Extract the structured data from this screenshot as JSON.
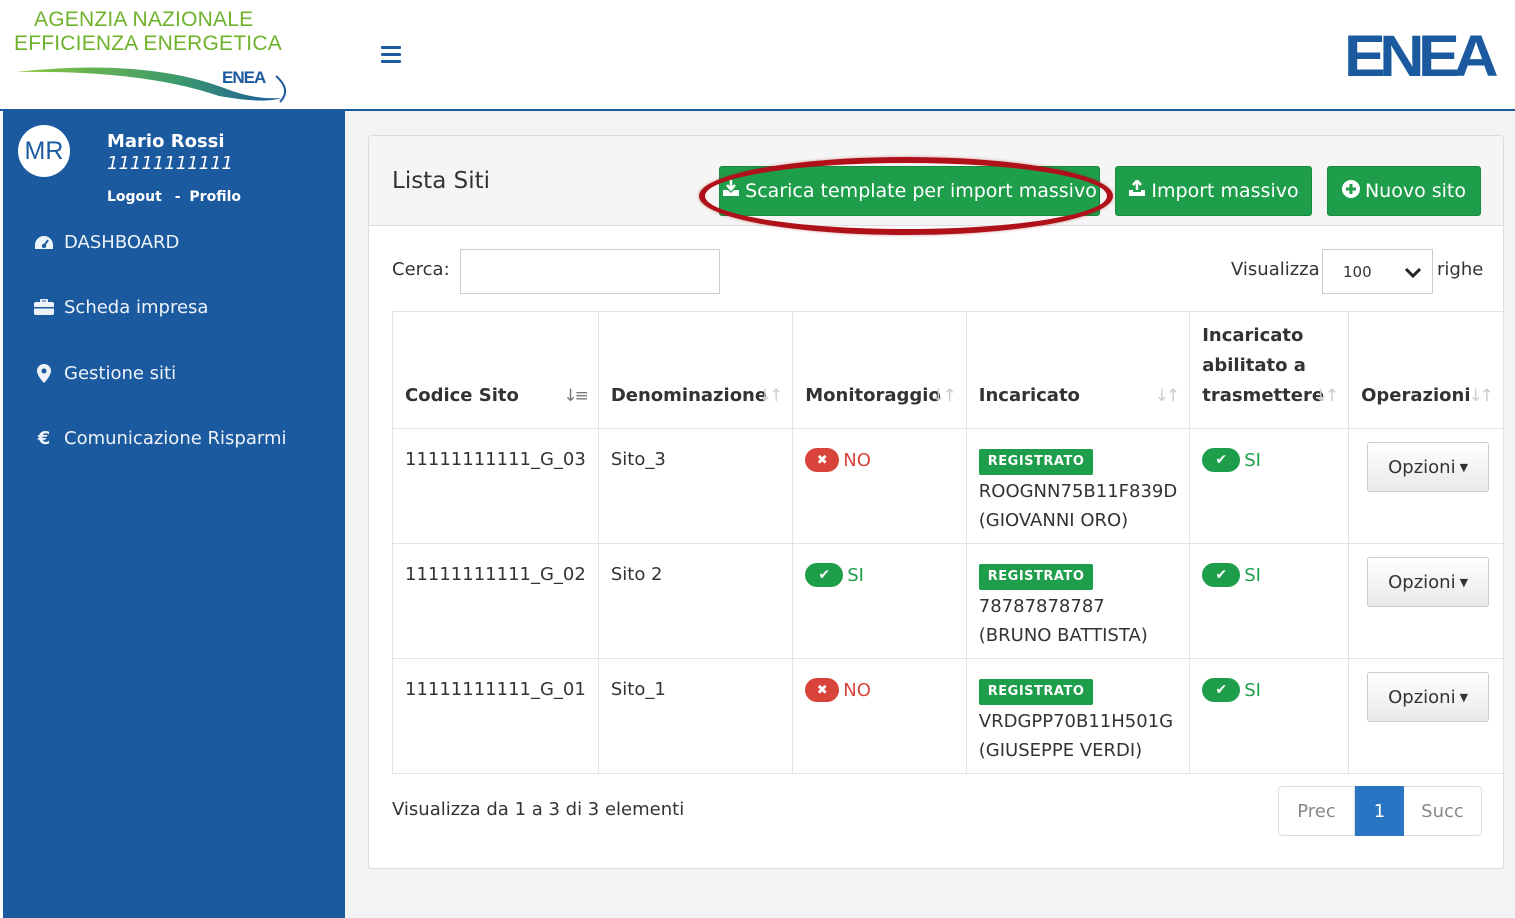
{
  "header": {
    "agency_line1": "AGENZIA NAZIONALE",
    "agency_line2": "EFFICIENZA ENERGETICA",
    "agency_mini_logo": "ENEA",
    "logo_text": "ENEA"
  },
  "user": {
    "initials": "MR",
    "name": "Mario Rossi",
    "code": "11111111111",
    "logout_label": "Logout",
    "separator": "-",
    "profile_label": "Profilo"
  },
  "sidebar": {
    "items": [
      {
        "label": "DASHBOARD",
        "icon": "dashboard-icon"
      },
      {
        "label": "Scheda impresa",
        "icon": "briefcase-icon"
      },
      {
        "label": "Gestione siti",
        "icon": "map-marker-icon"
      },
      {
        "label": "Comunicazione Risparmi",
        "icon": "euro-icon"
      }
    ]
  },
  "panel": {
    "title": "Lista Siti",
    "buttons": {
      "download_template": "Scarica template per import massivo",
      "import": "Import massivo",
      "new_site": "Nuovo sito"
    },
    "search_label": "Cerca:",
    "search_value": "",
    "show_label": "Visualizza",
    "rows_value": "100",
    "rows_suffix": "righe"
  },
  "table": {
    "columns": [
      "Codice Sito",
      "Denominazione",
      "Monitoraggio",
      "Incaricato",
      "Incaricato abilitato a trasmettere",
      "Operazioni"
    ],
    "rows": [
      {
        "codice": "11111111111_G_03",
        "denominazione": "Sito_3",
        "monitoraggio": "NO",
        "stato": "REGISTRATO",
        "incaricato_code": "ROOGNN75B11F839D",
        "incaricato_name": "(GIOVANNI ORO)",
        "abilitato": "SI",
        "operazioni": "Opzioni"
      },
      {
        "codice": "11111111111_G_02",
        "denominazione": "Sito 2",
        "monitoraggio": "SI",
        "stato": "REGISTRATO",
        "incaricato_code": "78787878787",
        "incaricato_name": "(BRUNO BATTISTA)",
        "abilitato": "SI",
        "operazioni": "Opzioni"
      },
      {
        "codice": "11111111111_G_01",
        "denominazione": "Sito_1",
        "monitoraggio": "NO",
        "stato": "REGISTRATO",
        "incaricato_code": "VRDGPP70B11H501G",
        "incaricato_name": "(GIUSEPPE VERDI)",
        "abilitato": "SI",
        "operazioni": "Opzioni"
      }
    ]
  },
  "footer": {
    "info": "Visualizza da 1 a 3 di 3 elementi",
    "prev": "Prec",
    "current_page": "1",
    "next": "Succ"
  },
  "colors": {
    "primary": "#1b5a9f",
    "success": "#1e9e4b",
    "danger": "#d9443a",
    "highlight": "#b01018",
    "page_active": "#2a74c4"
  }
}
